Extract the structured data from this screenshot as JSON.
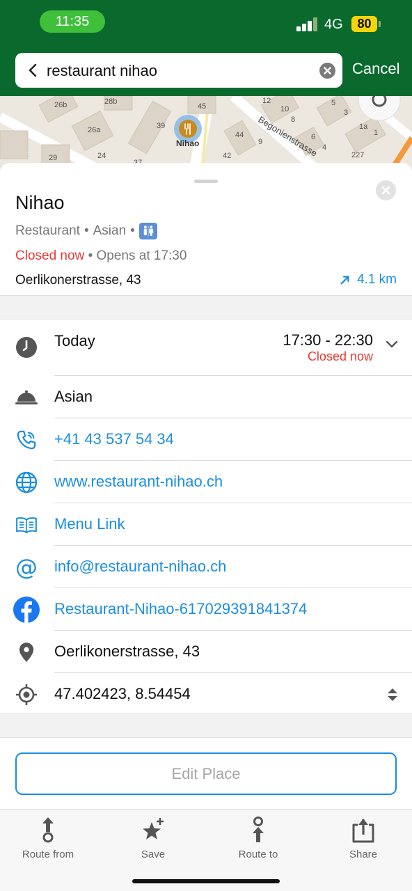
{
  "status_bar": {
    "time": "11:35",
    "network": "4G",
    "battery": "80"
  },
  "search": {
    "query": "restaurant nihao",
    "cancel_label": "Cancel"
  },
  "map": {
    "pin_label": "Nihao",
    "street_label": "Begonienstrasse",
    "house_numbers": [
      "26b",
      "28b",
      "45",
      "12",
      "10",
      "8",
      "5",
      "3",
      "1a",
      "1",
      "26a",
      "39",
      "44",
      "9",
      "6",
      "4",
      "227",
      "29",
      "24",
      "37",
      "42"
    ]
  },
  "place": {
    "name": "Nihao",
    "category": "Restaurant",
    "cuisine": "Asian",
    "status": "Closed now",
    "opens": "Opens at 17:30",
    "address": "Oerlikonerstrasse, 43",
    "distance": "4.1 km"
  },
  "details": {
    "hours_day": "Today",
    "hours_time": "17:30 - 22:30",
    "hours_status": "Closed now",
    "cuisine": "Asian",
    "phone": "+41 43 537 54 34",
    "website": "www.restaurant-nihao.ch",
    "menu": "Menu Link",
    "email": "info@restaurant-nihao.ch",
    "facebook": "Restaurant-Nihao-617029391841374",
    "address": "Oerlikonerstrasse, 43",
    "coordinates": "47.402423, 8.54454"
  },
  "edit_label": "Edit Place",
  "tabs": [
    {
      "label": "Route from",
      "icon": "route-from-icon"
    },
    {
      "label": "Save",
      "icon": "star-add-icon"
    },
    {
      "label": "Route to",
      "icon": "route-to-icon"
    },
    {
      "label": "Share",
      "icon": "share-icon"
    }
  ],
  "colors": {
    "header": "#0a6a2e",
    "accent": "#1a8ee0",
    "closed": "#e53b30"
  }
}
